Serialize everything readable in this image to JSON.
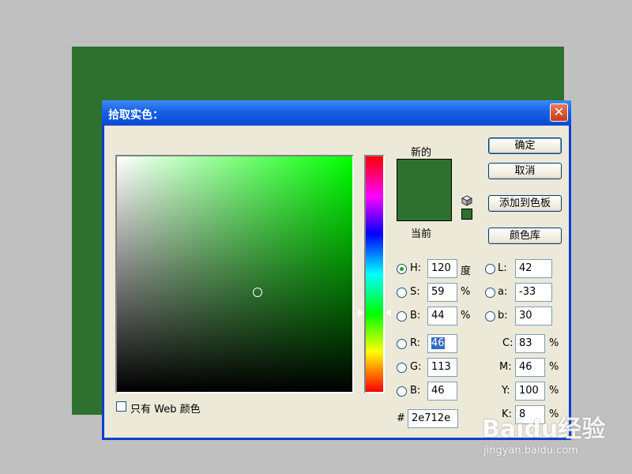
{
  "dialog": {
    "title": "拾取实色：",
    "close_glyph": "✕"
  },
  "preview": {
    "new_label": "新的",
    "current_label": "当前",
    "color": "#2e712e"
  },
  "buttons": {
    "ok": "确定",
    "cancel": "取消",
    "add_swatch": "添加到色板",
    "color_library": "颜色库"
  },
  "hsb": {
    "h_label": "H:",
    "h_value": "120",
    "h_unit": "度",
    "s_label": "S:",
    "s_value": "59",
    "s_unit": "%",
    "b_label": "B:",
    "b_value": "44",
    "b_unit": "%"
  },
  "lab": {
    "l_label": "L:",
    "l_value": "42",
    "a_label": "a:",
    "a_value": "-33",
    "b_label": "b:",
    "b_value": "30"
  },
  "rgb": {
    "r_label": "R:",
    "r_value": "46",
    "g_label": "G:",
    "g_value": "113",
    "b_label": "B:",
    "b_value": "46"
  },
  "cmyk": {
    "c_label": "C:",
    "c_value": "83",
    "c_unit": "%",
    "m_label": "M:",
    "m_value": "46",
    "m_unit": "%",
    "y_label": "Y:",
    "y_value": "100",
    "y_unit": "%",
    "k_label": "K:",
    "k_value": "8",
    "k_unit": "%"
  },
  "hex": {
    "label": "#",
    "value": "2e712e"
  },
  "web_only": {
    "label": "只有 Web 颜色",
    "checked": false
  },
  "watermark": {
    "brand": "Baidu经验",
    "url": "jingyan.baidu.com"
  },
  "colors": {
    "document_fill": "#2e712e",
    "titlebar": "#1560e6",
    "dialog_bg": "#ece9d8",
    "workspace_bg": "#c0c0c0"
  }
}
